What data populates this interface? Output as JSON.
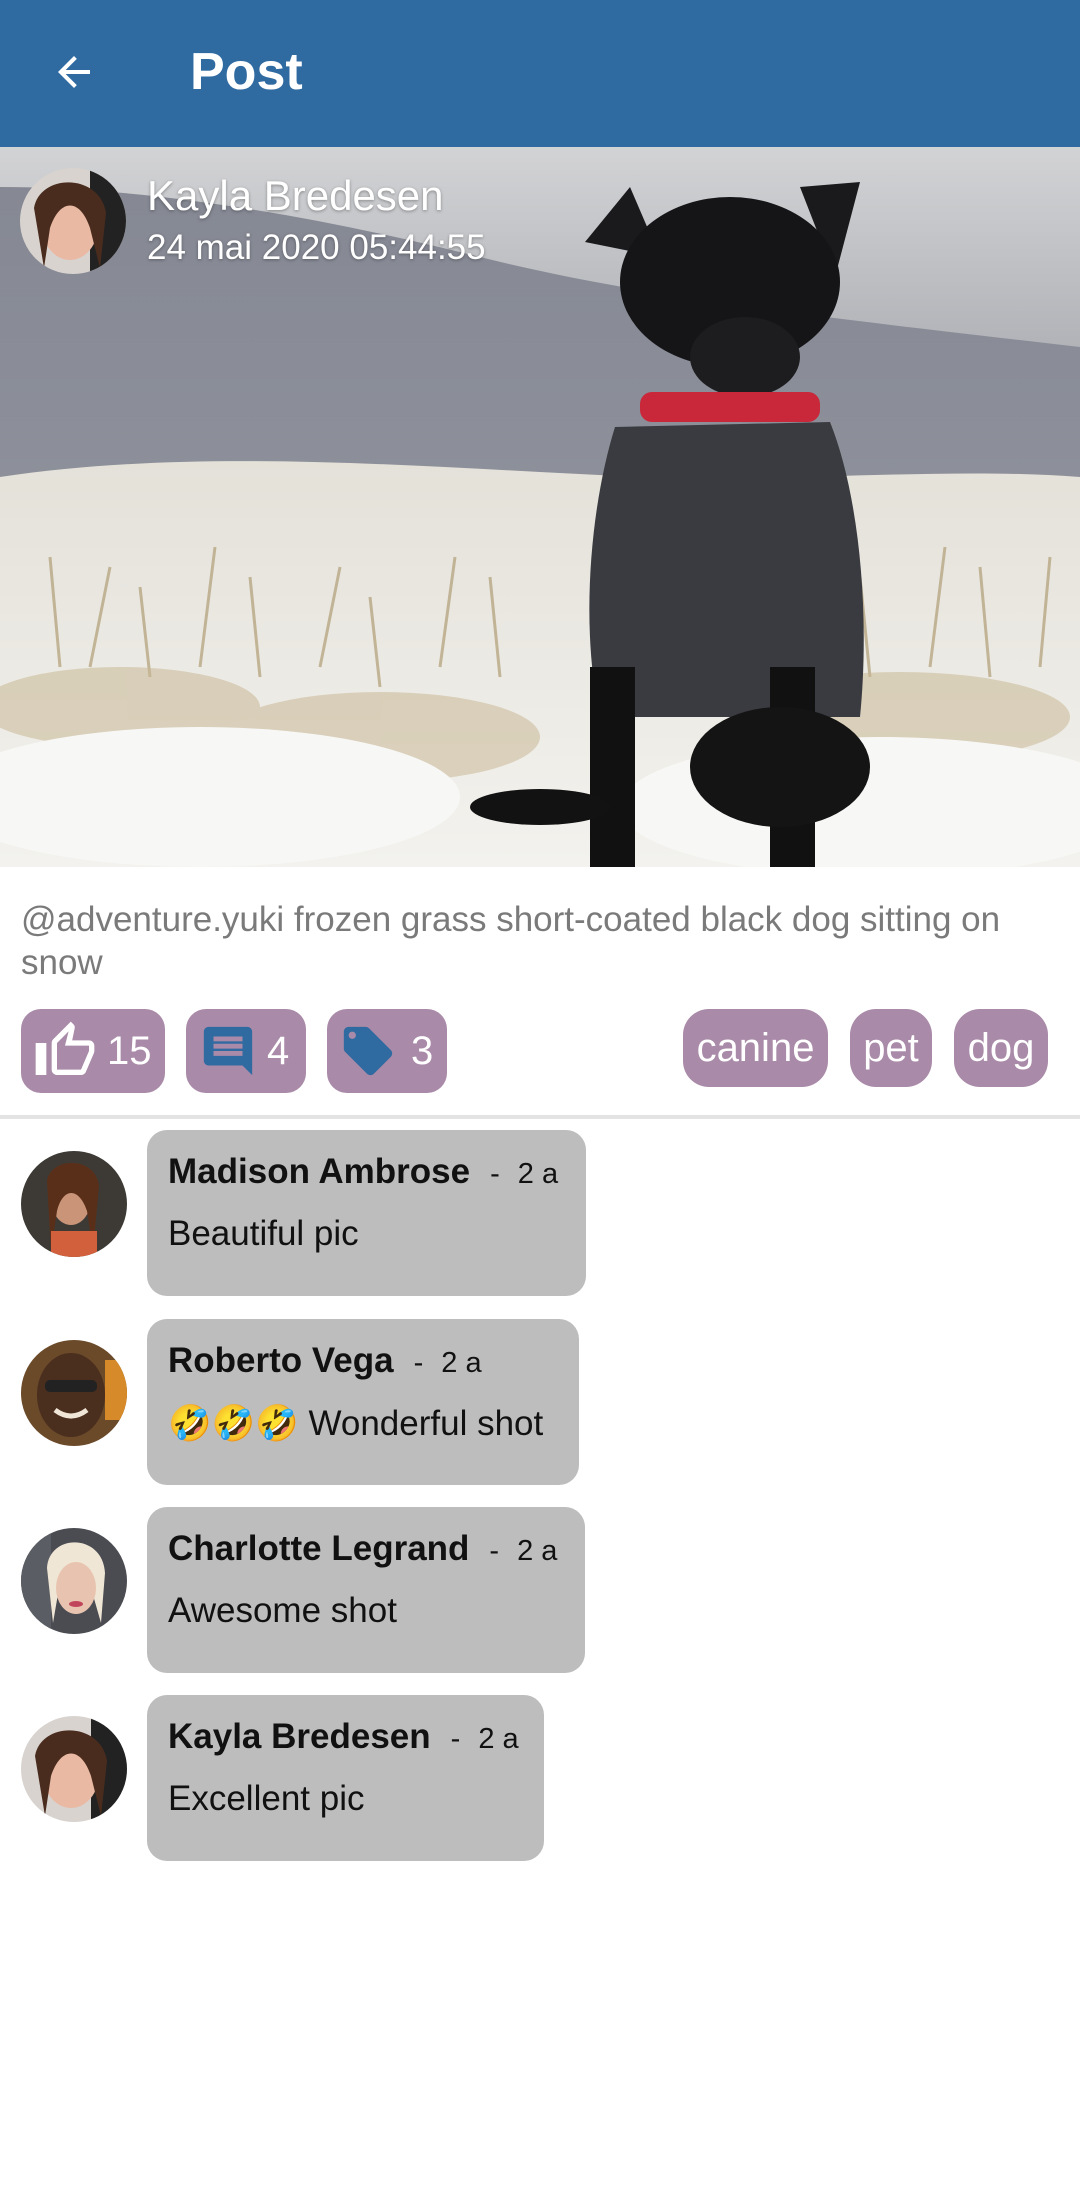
{
  "appbar": {
    "title": "Post",
    "back_icon": "arrow-back-icon",
    "color": "#2f6aa1"
  },
  "post": {
    "author": "Kayla Bredesen",
    "date": "24 mai 2020 05:44:55",
    "caption": "@adventure.yuki frozen grass short-coated black dog sitting on snow",
    "likes": "15",
    "comments_count": "4",
    "tags_count": "3",
    "tags": [
      "canine",
      "pet",
      "dog"
    ],
    "chip_color": "#a98aa8"
  },
  "comments": [
    {
      "name": "Madison Ambrose",
      "separator": "-",
      "time": "2 a",
      "text": "Beautiful pic"
    },
    {
      "name": "Roberto Vega",
      "separator": "-",
      "time": "2 a",
      "text": "🤣🤣🤣 Wonderful shot"
    },
    {
      "name": "Charlotte Legrand",
      "separator": "-",
      "time": "2 a",
      "text": "Awesome shot"
    },
    {
      "name": "Kayla Bredesen",
      "separator": "-",
      "time": "2 a",
      "text": "Excellent pic"
    }
  ]
}
